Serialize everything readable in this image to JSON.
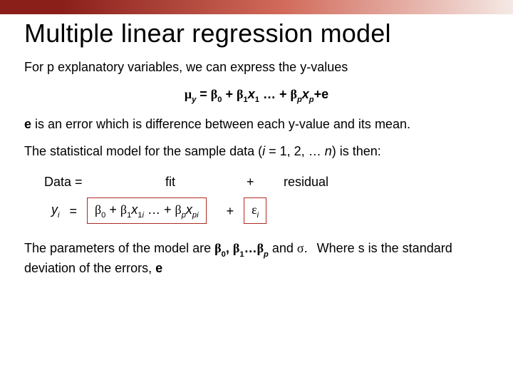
{
  "title": "Multiple linear regression model",
  "intro": "For p explanatory variables, we can express the y-values",
  "eq_main_html": "<span class='sym'>&mu;</span><span class='ital sub'>y</span> = <span class='sym'>&beta;</span><span class='sub'>0</span> + <span class='sym'>&beta;</span><span class='sub'>1</span><span class='ital'>x</span><span class='sub'>1</span> &hellip; + <span class='sym'>&beta;</span><span class='ital sub'>p</span><span class='ital'>x</span><span class='ital sub'>p</span>+<span class='bold'>e</span>",
  "error_html": "<span class='bold'>e</span> is an error which is difference between each y-value and its mean.",
  "stat_model_html": "The statistical model for the sample data (<span class='ital'>i</span> = 1, 2, &hellip; <span class='ital'>n</span>) is then:",
  "data_row": {
    "data": "Data =",
    "fit": "fit",
    "plus": "+",
    "residual": "residual"
  },
  "fit_row": {
    "yi_html": "y<span class='sub'>i</span>",
    "eq": "=",
    "fit_box_html": "<span class='sym'>&beta;</span><span class='sub'>0</span> + <span class='sym'>&beta;</span><span class='sub'>1</span><span class='ital'>x</span><span class='sub'>1<span class='ital'>i</span></span> &hellip; + <span class='sym'>&beta;</span><span class='ital sub'>p</span><span class='ital'>x</span><span class='ital sub'>pi</span>",
    "plus": "+",
    "resid_box_html": "<span class='sym'>&epsilon;</span><span class='ital sub'>i</span>"
  },
  "params_html": "The parameters of the model are <span class='bold'><span class='sym'>&beta;</span><span class='sub'>0</span>, <span class='sym'>&beta;</span><span class='sub'>1</span>&hellip;<span class='sym'>&beta;</span><span class='ital sub'>p</span></span> and <span class='sym'>&sigma;</span>.<span class='gap-small'></span> Where s is the standard deviation of the errors, <span class='bold'>e</span>"
}
